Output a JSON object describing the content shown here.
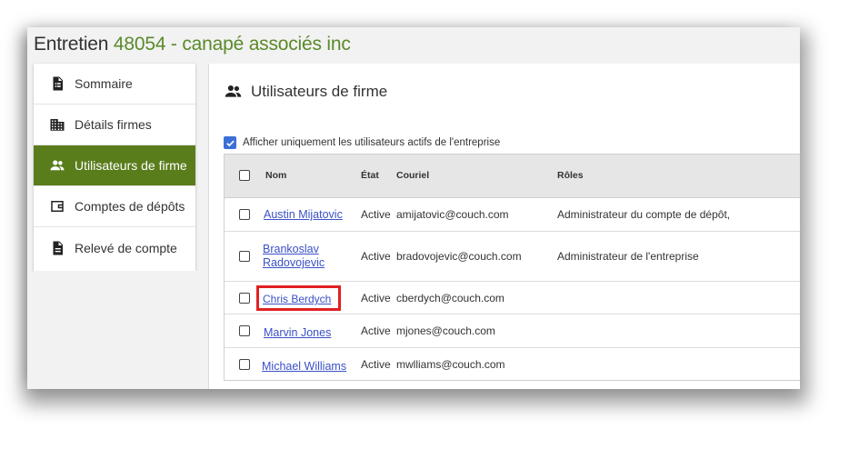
{
  "page": {
    "title_prefix": "Entretien",
    "title_rest": "48054 - canapé associés inc"
  },
  "sidebar": {
    "items": [
      {
        "label": "Sommaire",
        "icon": "summary-icon"
      },
      {
        "label": "Détails firmes",
        "icon": "building-icon"
      },
      {
        "label": "Utilisateurs de firme",
        "icon": "people-icon",
        "active": true
      },
      {
        "label": "Comptes de dépôts",
        "icon": "deposit-account-icon"
      },
      {
        "label": "Relevé de compte",
        "icon": "document-icon"
      }
    ]
  },
  "main": {
    "section_title": "Utilisateurs de firme",
    "filter_label": "Afficher uniquement les utilisateurs actifs de l'entreprise",
    "filter_checked": true,
    "columns": [
      "Nom",
      "État",
      "Couriel",
      "Rôles"
    ],
    "rows": [
      {
        "name": "Austin Mijatovic",
        "name_line2": "",
        "state": "Active",
        "email": "amijatovic@couch.com",
        "roles": "Administrateur du compte de dépôt,"
      },
      {
        "name": "Brankoslav",
        "name_line2": "Radovojevic",
        "state": "Active",
        "email": "bradovojevic@couch.com",
        "roles": "Administrateur de l'entreprise"
      },
      {
        "name": "Chris Berdych",
        "name_line2": "",
        "state": "Active",
        "email": "cberdych@couch.com",
        "roles": ""
      },
      {
        "name": "Marvin Jones",
        "name_line2": "",
        "state": "Active",
        "email": "mjones@couch.com",
        "roles": ""
      },
      {
        "name": "Michael Williams",
        "name_line2": "",
        "state": "Active",
        "email": "mwlliams@couch.com",
        "roles": ""
      }
    ]
  },
  "colors": {
    "accent_green": "#5a7d1c",
    "title_green": "#5a8a2a",
    "link_blue": "#3b50c7",
    "highlight_red": "#e02020",
    "checkbox_blue": "#3b6fd8"
  }
}
